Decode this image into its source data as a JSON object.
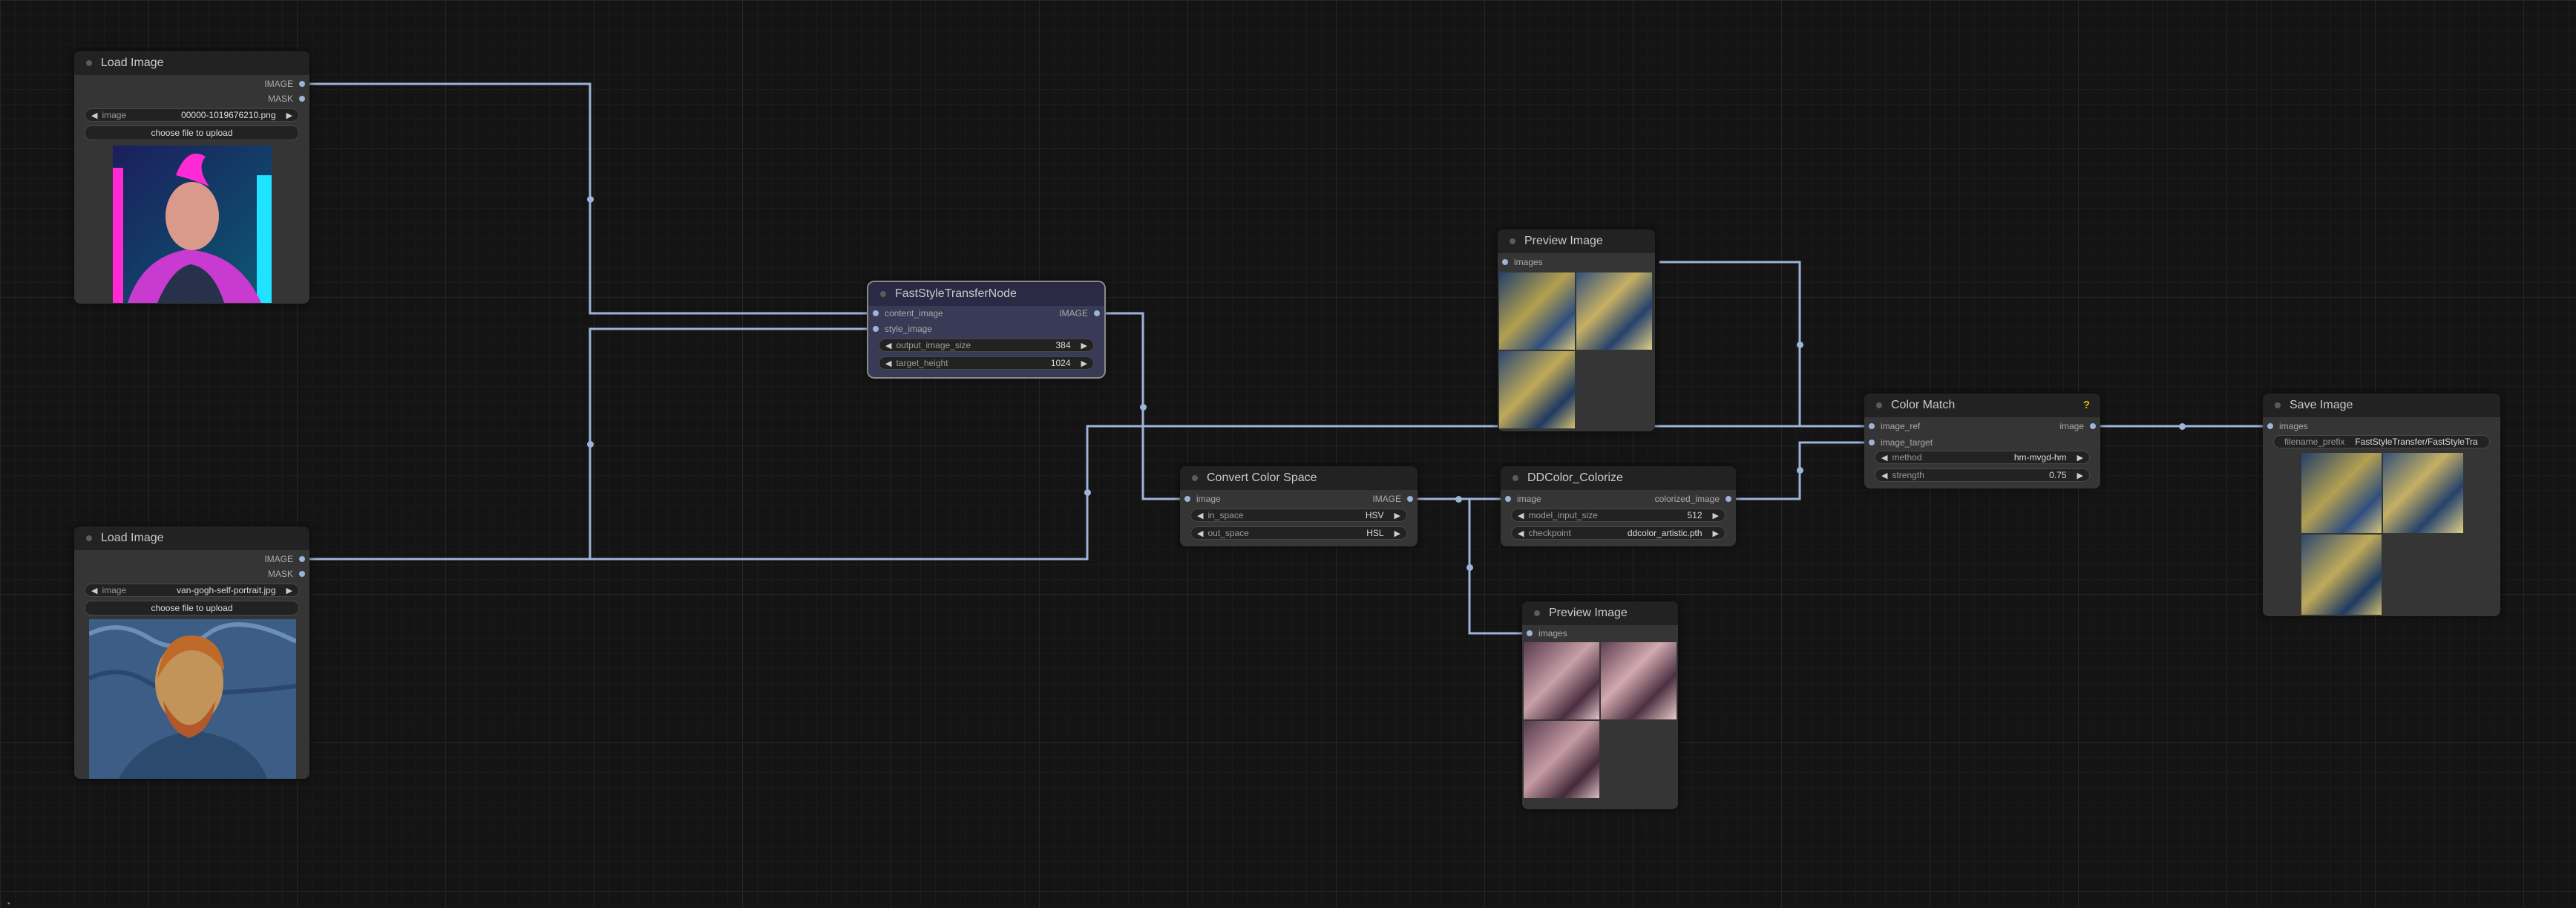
{
  "colors": {
    "link": "#9cb4d8",
    "node_bg": "#353535",
    "header_bg": "#222222",
    "canvas": "#141414"
  },
  "nodes": {
    "load_image_1": {
      "title": "Load Image",
      "outputs": [
        "IMAGE",
        "MASK"
      ],
      "widget": {
        "label": "image",
        "value": "00000-1019676210.png"
      },
      "upload_label": "choose file to upload"
    },
    "load_image_2": {
      "title": "Load Image",
      "outputs": [
        "IMAGE",
        "MASK"
      ],
      "widget": {
        "label": "image",
        "value": "van-gogh-self-portrait.jpg"
      },
      "upload_label": "choose file to upload"
    },
    "style_transfer": {
      "title": "FastStyleTransferNode",
      "inputs": [
        "content_image",
        "style_image"
      ],
      "outputs": [
        "IMAGE"
      ],
      "widgets": [
        {
          "label": "output_image_size",
          "value": "384"
        },
        {
          "label": "target_height",
          "value": "1024"
        }
      ]
    },
    "preview_1": {
      "title": "Preview Image",
      "inputs": [
        "images"
      ]
    },
    "convert_color": {
      "title": "Convert Color Space",
      "inputs": [
        "image"
      ],
      "outputs": [
        "IMAGE"
      ],
      "widgets": [
        {
          "label": "in_space",
          "value": "HSV"
        },
        {
          "label": "out_space",
          "value": "HSL"
        }
      ]
    },
    "ddcolor": {
      "title": "DDColor_Colorize",
      "inputs": [
        "image"
      ],
      "outputs": [
        "colorized_image"
      ],
      "widgets": [
        {
          "label": "model_input_size",
          "value": "512"
        },
        {
          "label": "checkpoint",
          "value": "ddcolor_artistic.pth"
        }
      ]
    },
    "preview_2": {
      "title": "Preview Image",
      "inputs": [
        "images"
      ]
    },
    "color_match": {
      "title": "Color Match",
      "help": "?",
      "inputs": [
        "image_ref",
        "image_target"
      ],
      "outputs": [
        "image"
      ],
      "widgets": [
        {
          "label": "method",
          "value": "hm-mvgd-hm"
        },
        {
          "label": "strength",
          "value": "0.75"
        }
      ]
    },
    "save_image": {
      "title": "Save Image",
      "inputs": [
        "images"
      ],
      "widget": {
        "label": "filename_prefix",
        "value": "FastStyleTransfer/FastStyleTra"
      }
    }
  }
}
